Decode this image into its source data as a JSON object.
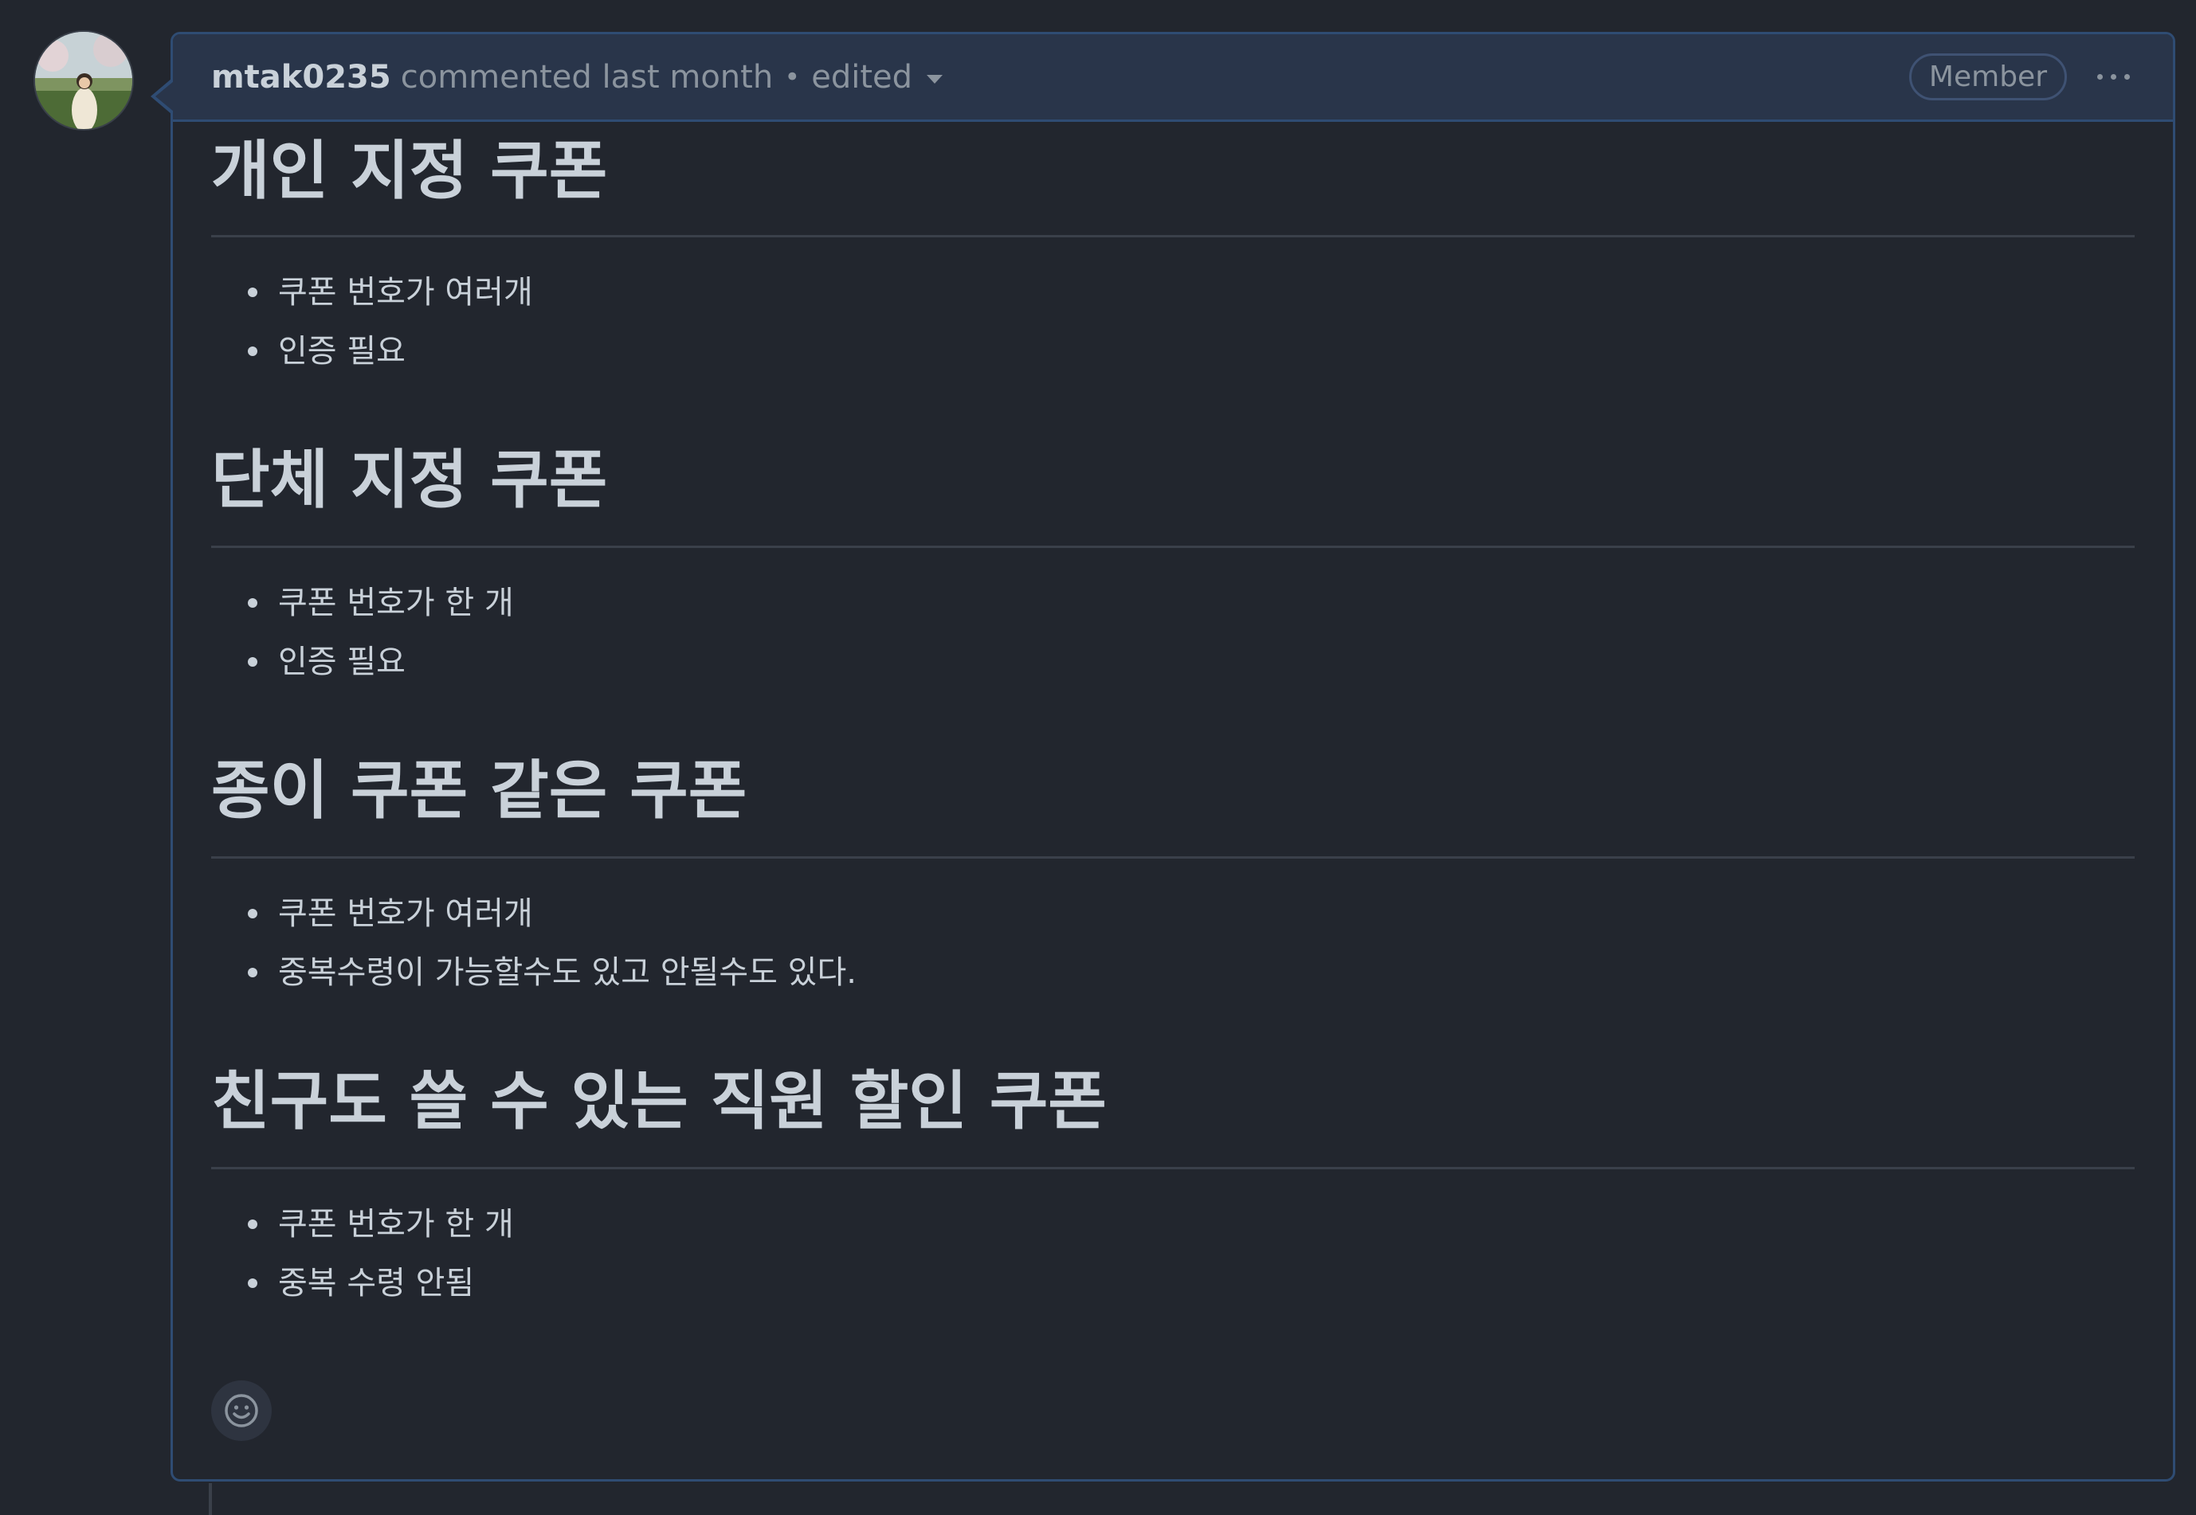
{
  "comment": {
    "author": "mtak0235",
    "action": "commented last month",
    "separator": "•",
    "edited_label": "edited",
    "badge": "Member",
    "icons": {
      "avatar": "user-avatar",
      "more": "kebab-horizontal-icon",
      "edited_dropdown": "triangle-down-icon",
      "reaction": "smiley-icon"
    },
    "sections": [
      {
        "title": "개인 지정 쿠폰",
        "items": [
          "쿠폰 번호가 여러개",
          "인증 필요"
        ]
      },
      {
        "title": "단체 지정 쿠폰",
        "items": [
          "쿠폰 번호가 한 개",
          "인증 필요"
        ]
      },
      {
        "title": "종이 쿠폰 같은 쿠폰",
        "items": [
          "쿠폰 번호가 여러개",
          "중복수령이 가능할수도 있고 안될수도 있다."
        ]
      },
      {
        "title": "친구도 쓸 수 있는 직원 할인 쿠폰",
        "items": [
          "쿠폰 번호가 한 개",
          "중복 수령 안됨"
        ]
      }
    ]
  },
  "colors": {
    "background": "#22262e",
    "header_background": "#29354a",
    "border_accent": "#2f4c73",
    "text_primary": "#c9d1d9",
    "text_muted": "#8b949e"
  }
}
